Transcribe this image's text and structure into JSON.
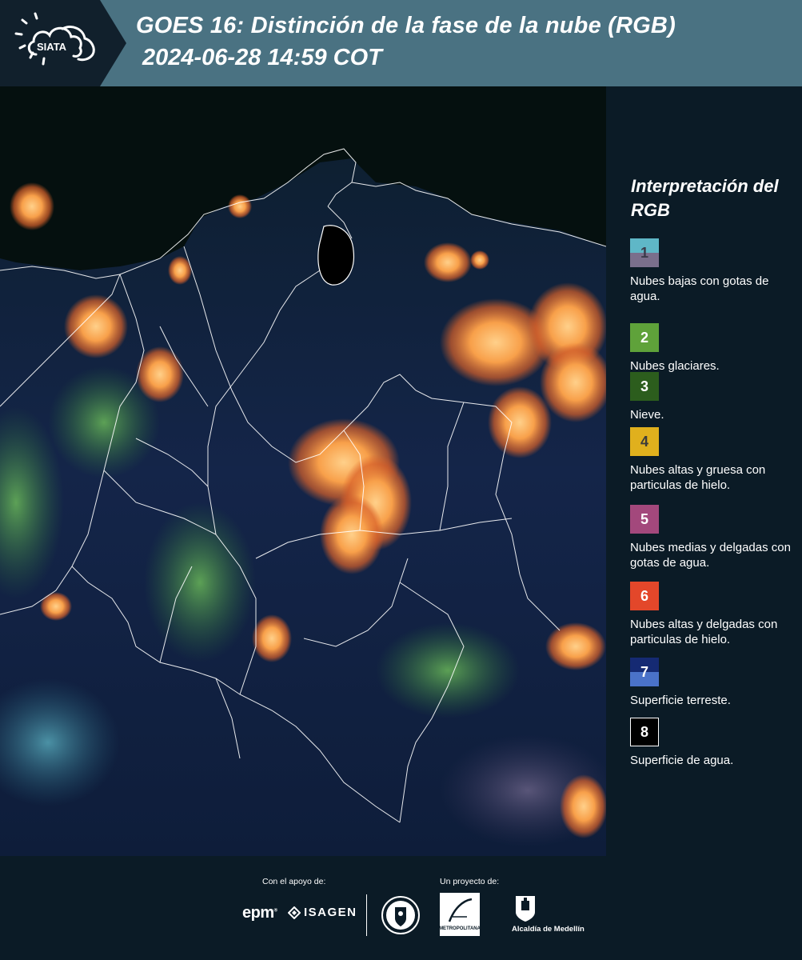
{
  "header": {
    "logo_text": "SIATA",
    "title": "GOES 16: Distinción de la fase de la nube (RGB)",
    "timestamp": "2024-06-28 14:59 COT",
    "background_color": "#4a7282"
  },
  "legend": {
    "title": "Interpretación del RGB",
    "items": [
      {
        "number": "1",
        "label": "Nubes bajas con gotas de agua.",
        "color_top": "#5fb7c7",
        "color_bottom": "#7a6f8c",
        "text_color": "#3b3b4a"
      },
      {
        "number": "2",
        "label": "Nubes glaciares.",
        "color_top": "#5fa23a",
        "text_color": "#ffffff"
      },
      {
        "number": "3",
        "label": "Nieve.",
        "color_top": "#2c5d1d",
        "text_color": "#ffffff"
      },
      {
        "number": "4",
        "label": "Nubes altas y gruesa con particulas de hielo.",
        "color_top": "#e0b01d",
        "text_color": "#3b3b3b"
      },
      {
        "number": "5",
        "label": "Nubes medias y delgadas con gotas de agua.",
        "color_top": "#a3487c",
        "text_color": "#ffffff"
      },
      {
        "number": "6",
        "label": "Nubes altas y delgadas con particulas de hielo.",
        "color_top": "#e3472a",
        "text_color": "#ffffff"
      },
      {
        "number": "7",
        "label": "Superficie terreste.",
        "color_top": "#152a73",
        "color_bottom": "#4a72c9",
        "text_color": "#ffffff"
      },
      {
        "number": "8",
        "label": "Superficie de agua.",
        "color_top": "#000000",
        "text_color": "#ffffff",
        "border": "#ffffff"
      }
    ]
  },
  "footer": {
    "support_label": "Con el apoyo de:",
    "project_label": "Un proyecto de:",
    "sponsors": [
      "epm",
      "ISAGEN"
    ],
    "partners": [
      "Área Metropolitana Valle de Aburrá",
      "Alcaldía de Medellín"
    ],
    "alcaldia_text": "Alcaldía de Medellín",
    "metro_text": "METROPOLITANA"
  }
}
